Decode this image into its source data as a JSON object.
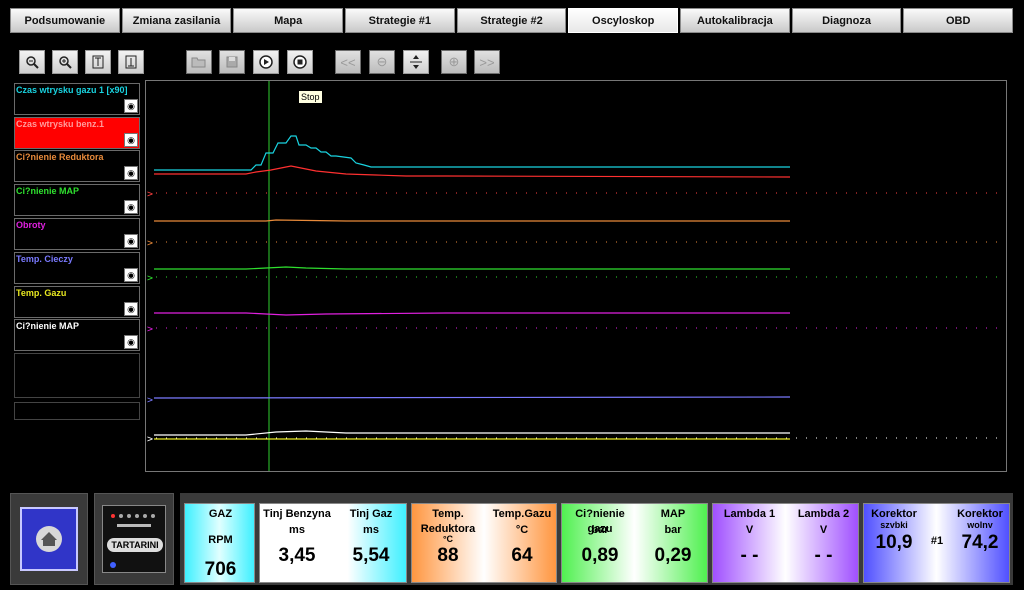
{
  "tabs": [
    "Podsumowanie",
    "Zmiana zasilania",
    "Mapa",
    "Strategie #1",
    "Strategie #2",
    "Oscyloskop",
    "Autokalibracja",
    "Diagnoza",
    "OBD"
  ],
  "active_tab": "Oscyloskop",
  "toolbar": {
    "icons": [
      "zoom-out-icon",
      "zoom-in-icon",
      "fit-top-icon",
      "fit-bottom-icon",
      "open-folder-icon",
      "save-icon",
      "play-icon",
      "stop-icon",
      "rewind-icon",
      "minus-icon",
      "center-icon",
      "plus-icon",
      "forward-icon"
    ]
  },
  "tooltip": "Stop",
  "channels": [
    {
      "label": "Czas wtrysku gazu 1 [x90]",
      "color": "#19d3e0",
      "bg": "#000000"
    },
    {
      "label": "Czas wtrysku benz.1",
      "color": "#ff6a6a",
      "bg": "#ff0000"
    },
    {
      "label": "Ci?nienie Reduktora",
      "color": "#e88a3a",
      "bg": "#000000"
    },
    {
      "label": "Ci?nienie MAP",
      "color": "#2fe02f",
      "bg": "#000000"
    },
    {
      "label": "Obroty",
      "color": "#e020e0",
      "bg": "#000000"
    },
    {
      "label": "Temp. Cieczy",
      "color": "#7a7aff",
      "bg": "#000000"
    },
    {
      "label": "Temp. Gazu",
      "color": "#e8e820",
      "bg": "#000000"
    },
    {
      "label": "Ci?nienie MAP",
      "color": "#ffffff",
      "bg": "#000000"
    }
  ],
  "logo_text": "TARTARINI",
  "panels": {
    "gaz": {
      "title": "GAZ",
      "unit": "RPM",
      "value": "706"
    },
    "tinj_benz": {
      "label": "Tinj Benzyna",
      "unit": "ms",
      "value": "3,45"
    },
    "tinj_gaz": {
      "label": "Tinj Gaz",
      "unit": "ms",
      "value": "5,54"
    },
    "temp_red": {
      "label": "Temp.",
      "label2": "Reduktora",
      "unit": "°C",
      "value": "88"
    },
    "temp_gazu": {
      "label": "Temp.Gazu",
      "unit": "°C",
      "value": "64"
    },
    "cis_gazu": {
      "label": "Ci?nienie gazu",
      "unit": "bar",
      "value": "0,89"
    },
    "map": {
      "label": "MAP",
      "unit": "bar",
      "value": "0,29"
    },
    "lambda1": {
      "label": "Lambda 1",
      "unit": "V",
      "value": "- -"
    },
    "lambda2": {
      "label": "Lambda 2",
      "unit": "V",
      "value": "- -"
    },
    "kor_szybki": {
      "label": "Korektor",
      "label2": "szybki",
      "value": "10,9"
    },
    "kor_num": "#1",
    "kor_wolny": {
      "label": "Korektor",
      "label2": "wolny",
      "value": "74,2"
    }
  }
}
